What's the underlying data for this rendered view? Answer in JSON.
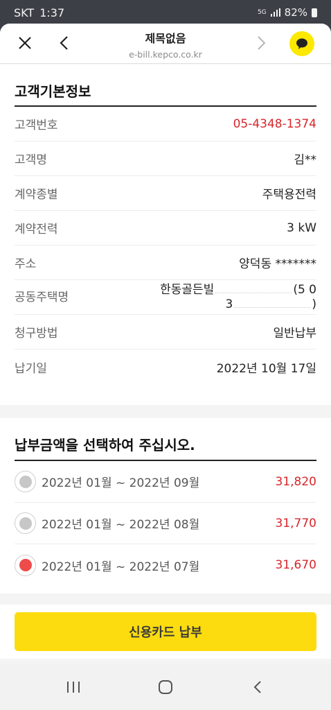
{
  "status_bar": {
    "carrier": "SKT",
    "time": "1:37",
    "network": "5G",
    "battery": "82%"
  },
  "browser": {
    "title": "제목없음",
    "url": "e-bill.kepco.co.kr"
  },
  "customer_info": {
    "section_title": "고객기본정보",
    "rows": [
      {
        "label": "고객번호",
        "value": "05-4348-1374"
      },
      {
        "label": "고객명",
        "value": "김**"
      },
      {
        "label": "계약종별",
        "value": "주택용전력"
      },
      {
        "label": "계약전력",
        "value": "3 kW"
      },
      {
        "label": "주소",
        "value": "양덕동 *******"
      },
      {
        "label": "공동주택명",
        "value_line1_left": "한동골든빌",
        "value_line1_right": "(5 0",
        "value_line2_left": "3",
        "value_line2_right": ")"
      },
      {
        "label": "청구방법",
        "value": "일반납부"
      },
      {
        "label": "납기일",
        "value": "2022년 10월 17일"
      }
    ]
  },
  "payment": {
    "section_title": "납부금액을 선택하여 주십시오.",
    "options": [
      {
        "period": "2022년 01월 ~ 2022년 09월",
        "amount": "31,820",
        "selected": false
      },
      {
        "period": "2022년 01월 ~ 2022년 08월",
        "amount": "31,770",
        "selected": false
      },
      {
        "period": "2022년 01월 ~ 2022년 07월",
        "amount": "31,670",
        "selected": true
      }
    ]
  },
  "pay_button_label": "신용카드 납부",
  "colors": {
    "accent_yellow": "#fcdc0e",
    "amount_red": "#d7262b",
    "selected_radio": "#ee4b4b"
  }
}
